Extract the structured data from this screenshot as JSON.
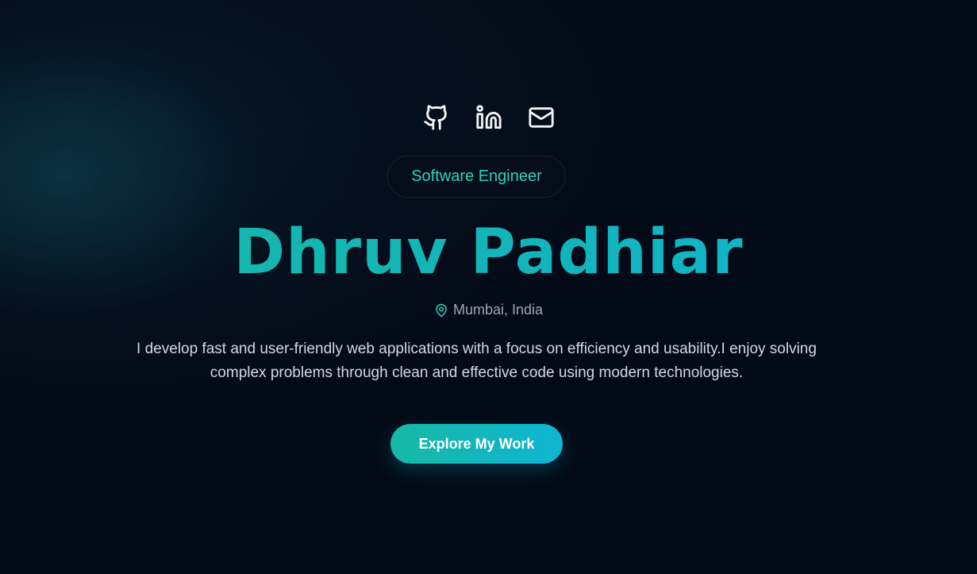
{
  "social": [
    {
      "icon": "github-icon"
    },
    {
      "icon": "linkedin-icon"
    },
    {
      "icon": "mail-icon"
    }
  ],
  "hero": {
    "role": "Software Engineer",
    "name": "Dhruv Padhiar",
    "location": "Mumbai, India",
    "bio": "I develop fast and user-friendly web applications with a focus on efficiency and usability.I enjoy solving complex problems through clean and effective code using modern technologies.",
    "cta_label": "Explore My Work"
  },
  "colors": {
    "background": "#030a17",
    "accent_teal": "#17b7a3",
    "accent_cyan": "#0fb2d0",
    "role_text": "#2fd3bb",
    "body_text": "#d3d9e2",
    "muted_text": "#9aa7b6"
  }
}
